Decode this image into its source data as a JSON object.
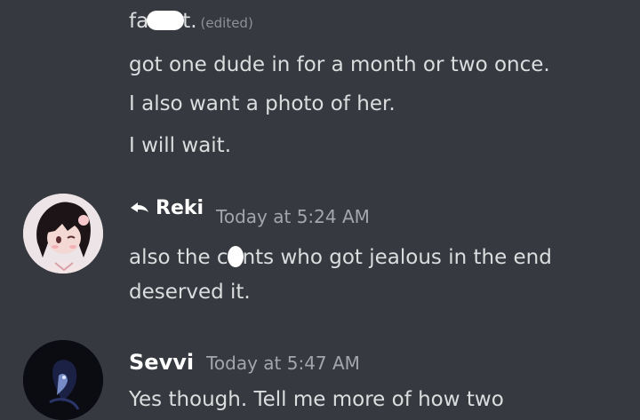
{
  "messages_top": {
    "line1_prefix": "fa",
    "line1_suffix": "t.",
    "edited_label": "(edited)",
    "line2": "got one dude in for a month or two once.",
    "line3": "I also want a photo of her.",
    "line4": "I will wait."
  },
  "reki": {
    "username": "Reki",
    "timestamp": "Today at 5:24 AM",
    "text_part1": "also the c",
    "text_part2": "nts who got jealous in the end",
    "text_line2": "deserved it."
  },
  "sevvi": {
    "username": "Sevvi",
    "timestamp": "Today at 5:47 AM",
    "text_partial": "Yes though. Tell me more of how two"
  },
  "colors": {
    "background": "#36393f",
    "text": "#dcddde",
    "username": "#ffffff",
    "timestamp": "#a3a6aa"
  }
}
